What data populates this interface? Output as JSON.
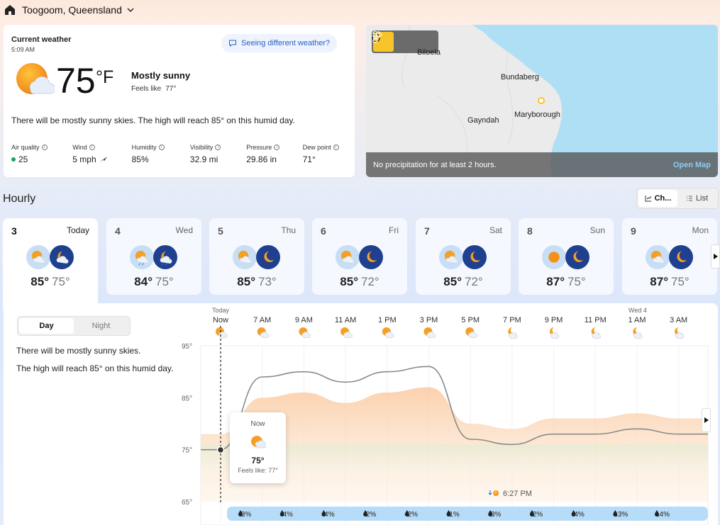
{
  "header": {
    "location": "Toogoom, Queensland"
  },
  "current": {
    "title": "Current weather",
    "time": "5:09 AM",
    "different_label": "Seeing different weather?",
    "temp": "75",
    "unit": "°F",
    "condition": "Mostly sunny",
    "feels_label": "Feels like",
    "feels_value": "77°",
    "description": "There will be mostly sunny skies. The high will reach 85° on this humid day.",
    "metrics": [
      {
        "label": "Air quality",
        "value": "25"
      },
      {
        "label": "Wind",
        "value": "5 mph"
      },
      {
        "label": "Humidity",
        "value": "85%"
      },
      {
        "label": "Visibility",
        "value": "32.9 mi"
      },
      {
        "label": "Pressure",
        "value": "29.86 in"
      },
      {
        "label": "Dew point",
        "value": "71°"
      }
    ]
  },
  "map": {
    "places": [
      "Biloela",
      "Bundaberg",
      "Maryborough",
      "Gayndah"
    ],
    "status": "No precipitation for at least 2 hours.",
    "open_label": "Open Map",
    "accent": "#f7c52b"
  },
  "hourly": {
    "title": "Hourly",
    "view_chart": "Ch...",
    "view_list": "List"
  },
  "days": [
    {
      "num": "3",
      "day": "Today",
      "hi": "85°",
      "lo": "75°",
      "icons": [
        "partly-sunny-icon",
        "partly-cloudy-night-icon"
      ]
    },
    {
      "num": "4",
      "day": "Wed",
      "hi": "84°",
      "lo": "75°",
      "icons": [
        "sun-rain-icon",
        "night-rain-icon"
      ]
    },
    {
      "num": "5",
      "day": "Thu",
      "hi": "85°",
      "lo": "73°",
      "icons": [
        "partly-sunny-icon",
        "moon-icon"
      ]
    },
    {
      "num": "6",
      "day": "Fri",
      "hi": "85°",
      "lo": "72°",
      "icons": [
        "partly-sunny-icon",
        "moon-icon"
      ]
    },
    {
      "num": "7",
      "day": "Sat",
      "hi": "85°",
      "lo": "72°",
      "icons": [
        "partly-sunny-icon",
        "moon-icon"
      ]
    },
    {
      "num": "8",
      "day": "Sun",
      "hi": "87°",
      "lo": "75°",
      "icons": [
        "sun-icon",
        "moon-icon"
      ]
    },
    {
      "num": "9",
      "day": "Mon",
      "hi": "87°",
      "lo": "75°",
      "icons": [
        "partly-sunny-icon",
        "moon-icon"
      ]
    }
  ],
  "detail": {
    "day_label": "Day",
    "night_label": "Night",
    "line1": "There will be mostly sunny skies.",
    "line2": "The high will reach 85° on this humid day."
  },
  "chart_data": {
    "type": "line",
    "x": [
      "Now",
      "7 AM",
      "9 AM",
      "11 AM",
      "1 PM",
      "3 PM",
      "5 PM",
      "7 PM",
      "9 PM",
      "11 PM",
      "1 AM",
      "3 AM"
    ],
    "x_day_labels": {
      "0": "Today",
      "10": "Wed 4"
    },
    "ylim": [
      65,
      95
    ],
    "yticks": [
      "95°",
      "85°",
      "75°",
      "65°"
    ],
    "series": [
      {
        "values": [
          75,
          89,
          90,
          88,
          90,
          91,
          77,
          76,
          78,
          78,
          79,
          78
        ]
      }
    ],
    "precip_chance": [
      "3%",
      "4%",
      "4%",
      "2%",
      "2%",
      "1%",
      "3%",
      "2%",
      "4%",
      "13%",
      "14%"
    ],
    "sunset": "6:27 PM",
    "tooltip": {
      "title": "Now",
      "temp": "75°",
      "feels": "Feels like: 77°"
    }
  }
}
